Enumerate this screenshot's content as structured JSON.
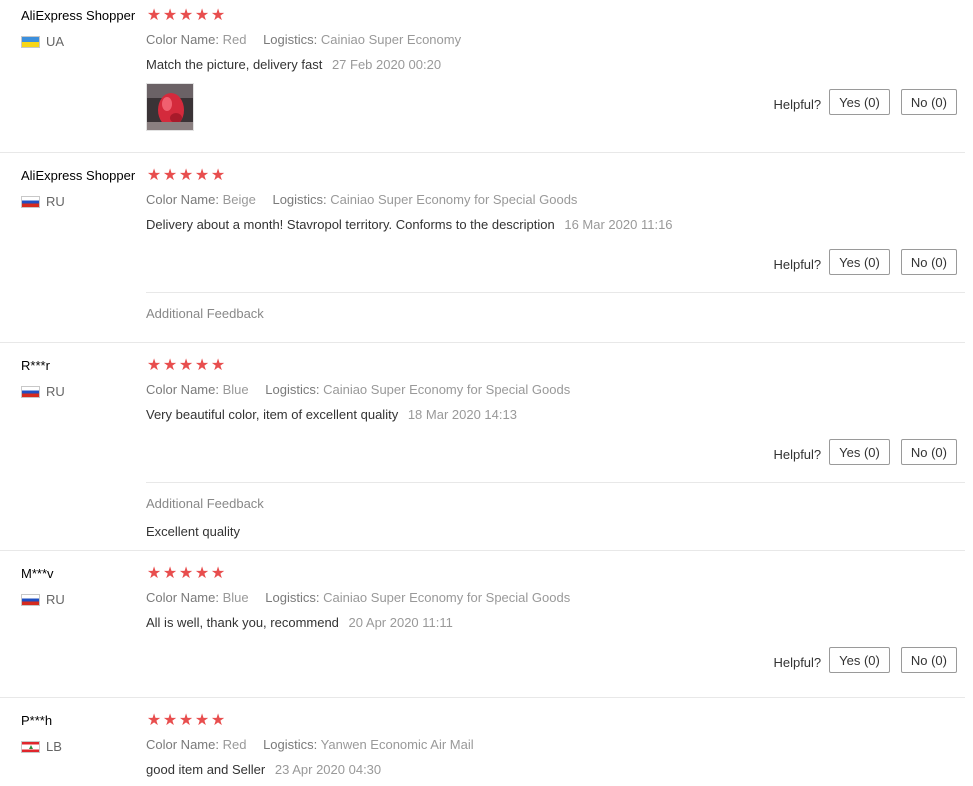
{
  "reviews": [
    {
      "user": "AliExpress Shopper",
      "country": "UA",
      "flag": "flag-ua-icon",
      "rating": 5,
      "color_key": "Color Name:",
      "color_value": "Red",
      "logistics_key": "Logistics:",
      "logistics_value": "Cainiao Super Economy",
      "text": "Match the picture, delivery fast",
      "date": "27 Feb 2020 00:20",
      "helpful_label": "Helpful?",
      "yes_label": "Yes (0)",
      "no_label": "No (0)"
    },
    {
      "user": "AliExpress Shopper",
      "country": "RU",
      "flag": "flag-ru-icon",
      "rating": 5,
      "color_key": "Color Name:",
      "color_value": "Beige",
      "logistics_key": "Logistics:",
      "logistics_value": "Cainiao Super Economy for Special Goods",
      "text": "Delivery about a month! Stavropol territory. Conforms to the description",
      "date": "16 Mar 2020 11:16",
      "helpful_label": "Helpful?",
      "yes_label": "Yes (0)",
      "no_label": "No (0)",
      "additional_feedback_label": "Additional Feedback"
    },
    {
      "user": "R***r",
      "country": "RU",
      "flag": "flag-ru-icon",
      "rating": 5,
      "color_key": "Color Name:",
      "color_value": "Blue",
      "logistics_key": "Logistics:",
      "logistics_value": "Cainiao Super Economy for Special Goods",
      "text": "Very beautiful color, item of excellent quality",
      "date": "18 Mar 2020 14:13",
      "helpful_label": "Helpful?",
      "yes_label": "Yes (0)",
      "no_label": "No (0)",
      "additional_feedback_label": "Additional Feedback",
      "additional_feedback_text": "Excellent quality"
    },
    {
      "user": "M***v",
      "country": "RU",
      "flag": "flag-ru-icon",
      "rating": 5,
      "color_key": "Color Name:",
      "color_value": "Blue",
      "logistics_key": "Logistics:",
      "logistics_value": "Cainiao Super Economy for Special Goods",
      "text": "All is well, thank you, recommend",
      "date": "20 Apr 2020 11:11",
      "helpful_label": "Helpful?",
      "yes_label": "Yes (0)",
      "no_label": "No (0)"
    },
    {
      "user": "P***h",
      "country": "LB",
      "flag": "flag-lb-icon",
      "rating": 5,
      "color_key": "Color Name:",
      "color_value": "Red",
      "logistics_key": "Logistics:",
      "logistics_value": "Yanwen Economic Air Mail",
      "text": "good item and Seller",
      "date": "23 Apr 2020 04:30"
    }
  ],
  "colors": {
    "star": "#e84e4e",
    "meta": "#999999",
    "divider": "#e8e8e8"
  },
  "star_glyph": "★"
}
